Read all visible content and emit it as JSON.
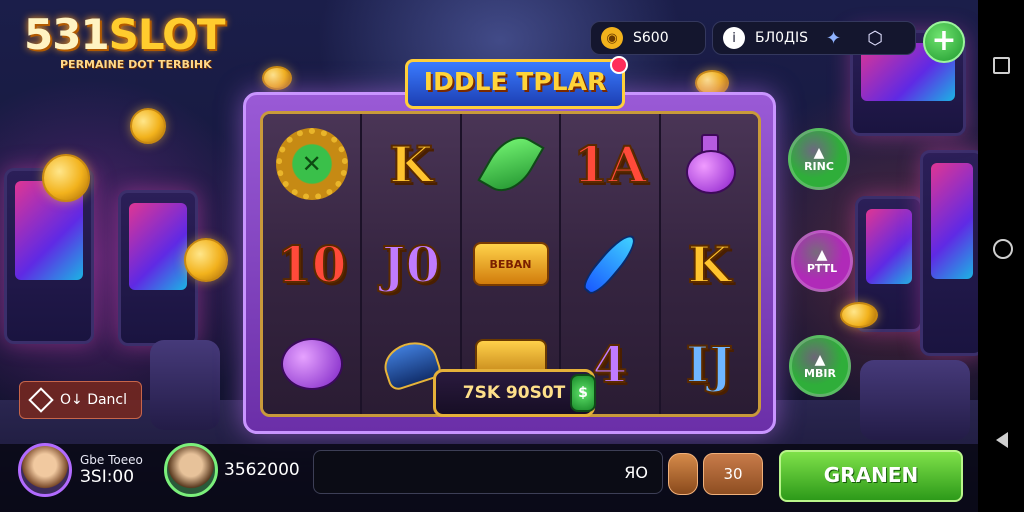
{
  "logo": {
    "title_main": "531",
    "title_slot": "SLOT",
    "subtitle": "PERMAINE DOT TERBIHK"
  },
  "header": {
    "coins_value": "S600",
    "gems_value": "БЛ0ДIS",
    "plus_label": "+"
  },
  "game": {
    "title": "IDDLE TPLAR",
    "reels": [
      [
        {
          "kind": "gear",
          "text": "✕"
        },
        {
          "kind": "text",
          "text": "10",
          "color": "red"
        },
        {
          "kind": "orb"
        }
      ],
      [
        {
          "kind": "text",
          "text": "K",
          "color": "gold"
        },
        {
          "kind": "text",
          "text": "J0",
          "color": "purple"
        },
        {
          "kind": "lantern"
        }
      ],
      [
        {
          "kind": "leaf"
        },
        {
          "kind": "banner",
          "text": "BEBAN"
        },
        {
          "kind": "chest"
        }
      ],
      [
        {
          "kind": "text",
          "text": "1A",
          "color": "red"
        },
        {
          "kind": "feather"
        },
        {
          "kind": "text",
          "text": "4",
          "color": "purple"
        }
      ],
      [
        {
          "kind": "potion"
        },
        {
          "kind": "text",
          "text": "K",
          "color": "gold"
        },
        {
          "kind": "text",
          "text": "IJ",
          "color": "blue"
        }
      ]
    ],
    "win_text": "7SK 90S0T",
    "win_bag": "$"
  },
  "side_buttons": [
    {
      "label": "RINC",
      "icon": "▲",
      "color": "#2fae3a"
    },
    {
      "label": "PTTL",
      "icon": "▲",
      "color": "#b02ab8"
    },
    {
      "label": "MBIR",
      "icon": "▲",
      "color": "#2fae3a"
    }
  ],
  "jackpot": {
    "label": "O↓ Dancl"
  },
  "players": [
    {
      "name": "Gbe Toeeo",
      "amount": "ЗSI:00"
    },
    {
      "name": "",
      "amount": "3562000"
    }
  ],
  "bet": {
    "value": "ЯO",
    "amount": "30"
  },
  "spin_label": "GRANEN"
}
